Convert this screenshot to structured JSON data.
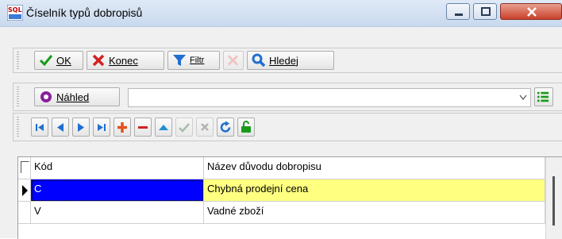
{
  "window": {
    "title": "Číselník typů dobropisů",
    "app_icon": "sql-icon"
  },
  "toolbar_main": {
    "ok_label": "OK",
    "ok_hotkey": "O",
    "konec_label": "Konec",
    "filtr_label": "Filtr",
    "hledej_label": "Hledej"
  },
  "toolbar_view": {
    "nahled_label": "Náhled",
    "combo_value": ""
  },
  "navigator": {
    "icons": [
      "first-icon",
      "prev-icon",
      "next-icon",
      "last-icon",
      "insert-icon",
      "delete-icon",
      "edit-up-icon",
      "post-icon",
      "cancel-icon",
      "refresh-icon",
      "lock-icon"
    ]
  },
  "grid": {
    "columns": [
      "Kód",
      "Název důvodu dobropisu"
    ],
    "rows": [
      {
        "kod": "C",
        "nazev": "Chybná prodejní cena",
        "selected": true
      },
      {
        "kod": "V",
        "nazev": "Vadné zboží",
        "selected": false
      }
    ]
  },
  "colors": {
    "selection_code": "#0000ff",
    "selection_name": "#ffff80",
    "ok_check": "#1a9a1a",
    "cancel_x": "#d42020",
    "nav_blue": "#1f6fd0"
  }
}
